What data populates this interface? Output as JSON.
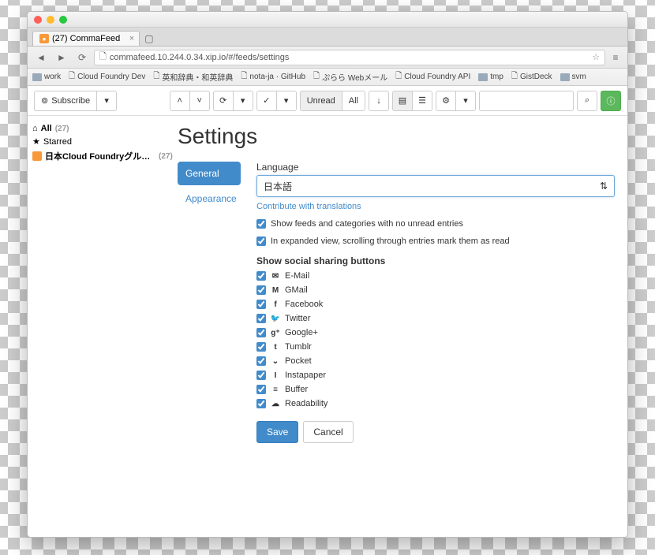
{
  "browser": {
    "tab_title": "(27) CommaFeed",
    "url": "commafeed.10.244.0.34.xip.io/#/feeds/settings",
    "bookmarks": [
      {
        "label": "work",
        "type": "folder"
      },
      {
        "label": "Cloud Foundry Dev",
        "type": "link"
      },
      {
        "label": "英和辞典・和英辞典",
        "type": "link"
      },
      {
        "label": "nota-ja · GitHub",
        "type": "link"
      },
      {
        "label": "ぷらら Webメール",
        "type": "link"
      },
      {
        "label": "Cloud Foundry API",
        "type": "link"
      },
      {
        "label": "tmp",
        "type": "folder"
      },
      {
        "label": "GistDeck",
        "type": "link"
      },
      {
        "label": "svm",
        "type": "folder"
      }
    ]
  },
  "toolbar": {
    "subscribe": "Subscribe",
    "unread": "Unread",
    "all": "All"
  },
  "sidebar": {
    "all_label": "All",
    "all_count": "(27)",
    "starred_label": "Starred",
    "feed_label": "日本Cloud Foundryグループ ブログ",
    "feed_count": "(27)"
  },
  "page": {
    "title": "Settings",
    "tabs": {
      "general": "General",
      "appearance": "Appearance"
    },
    "language_label": "Language",
    "language_value": "日本語",
    "contribute_link": "Contribute with translations",
    "chk_show_feeds": "Show feeds and categories with no unread entries",
    "chk_expanded": "In expanded view, scrolling through entries mark them as read",
    "social_title": "Show social sharing buttons",
    "social": [
      {
        "name": "E-Mail",
        "glyph": "✉"
      },
      {
        "name": "GMail",
        "glyph": "M"
      },
      {
        "name": "Facebook",
        "glyph": "f"
      },
      {
        "name": "Twitter",
        "glyph": "🐦"
      },
      {
        "name": "Google+",
        "glyph": "g⁺"
      },
      {
        "name": "Tumblr",
        "glyph": "t"
      },
      {
        "name": "Pocket",
        "glyph": "⌄"
      },
      {
        "name": "Instapaper",
        "glyph": "I"
      },
      {
        "name": "Buffer",
        "glyph": "≡"
      },
      {
        "name": "Readability",
        "glyph": "☁"
      }
    ],
    "save": "Save",
    "cancel": "Cancel"
  }
}
